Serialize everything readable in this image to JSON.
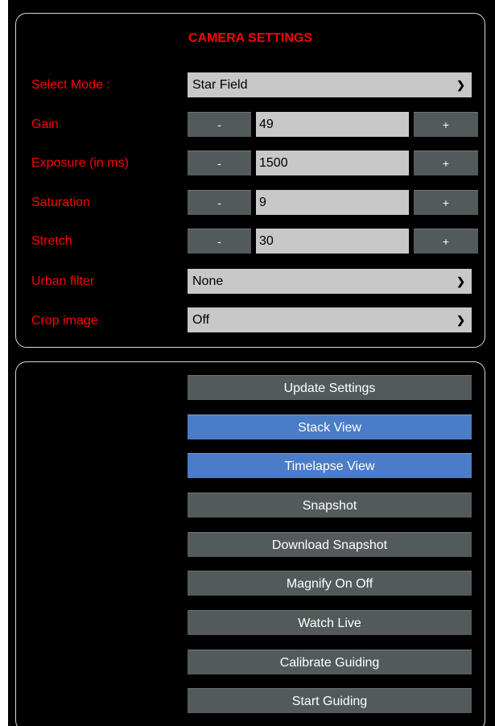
{
  "settings": {
    "title": "CAMERA SETTINGS",
    "select_mode": {
      "label": "Select Mode :",
      "value": "Star Field"
    },
    "gain": {
      "label": "Gain",
      "minus": "-",
      "value": "49",
      "plus": "+"
    },
    "exposure": {
      "label": "Exposure (in ms)",
      "minus": "-",
      "value": "1500",
      "plus": "+"
    },
    "saturation": {
      "label": "Saturation",
      "minus": "-",
      "value": "9",
      "plus": "+"
    },
    "stretch": {
      "label": "Stretch",
      "minus": "-",
      "value": "30",
      "plus": "+"
    },
    "urban_filter": {
      "label": "Urban filter",
      "value": "None"
    },
    "crop_image": {
      "label": "Crop image",
      "value": "Off"
    }
  },
  "actions": {
    "update_settings": "Update Settings",
    "stack_view": "Stack View",
    "timelapse_view": "Timelapse View",
    "snapshot": "Snapshot",
    "download_snapshot": "Download Snapshot",
    "magnify_on_off": "Magnify On Off",
    "watch_live": "Watch Live",
    "calibrate_guiding": "Calibrate Guiding",
    "start_guiding": "Start Guiding"
  },
  "icons": {
    "dropdown": "chevron-down-icon"
  },
  "colors": {
    "label_red": "#ff0000",
    "button_gray": "#525a5c",
    "button_active_blue": "#4a7cc7",
    "field_gray": "#c8c8c8"
  }
}
